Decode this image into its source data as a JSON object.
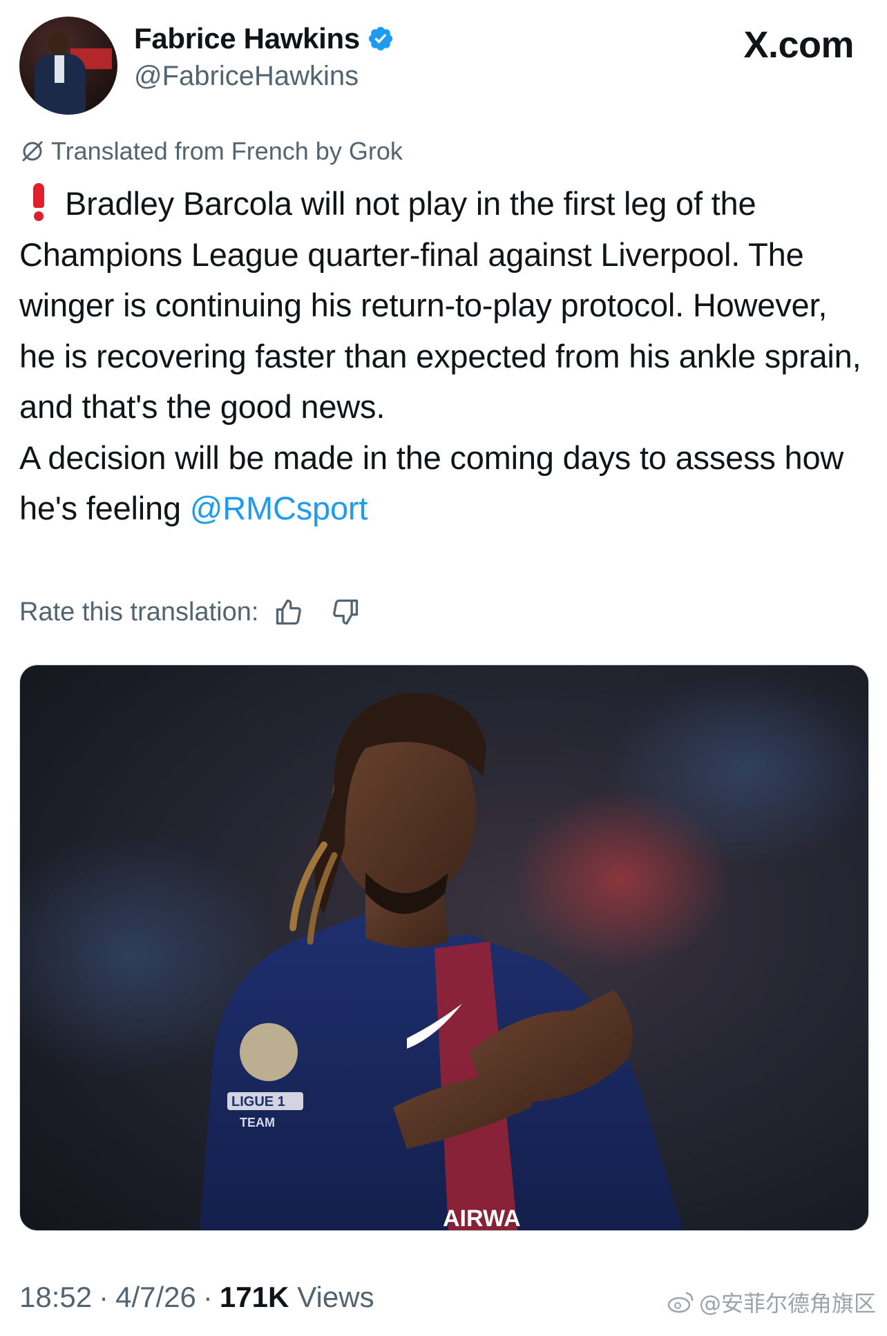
{
  "author": {
    "display_name": "Fabrice Hawkins",
    "handle": "@FabriceHawkins",
    "verified_color": "#1d9bf0",
    "avatar_icon": "profile-photo"
  },
  "site_brand": "X.com",
  "translation": {
    "notice": "Translated from French by Grok",
    "rate_label": "Rate this translation:",
    "thumbs_up_icon": "thumbs-up-icon",
    "thumbs_down_icon": "thumbs-down-icon"
  },
  "tweet": {
    "paragraph1": "Bradley Barcola will not play in the first leg of the Champions League quarter-final against Liverpool. The winger is continuing his return-to-play protocol. However, he is recovering faster than expected from his ankle sprain, and that's the good news.",
    "paragraph2": "A decision will be made in the coming days to assess how he's feeling",
    "mention": "@RMCsport",
    "alert_icon": "red-exclamation-icon"
  },
  "media": {
    "kit_badge_text": "LIGUE 1",
    "kit_team_text": "TEAM",
    "sponsor_text": "AIRWA"
  },
  "meta": {
    "time": "18:52",
    "separator": "·",
    "date": "4/7/26",
    "views_count": "171K",
    "views_label": "Views"
  },
  "watermark": {
    "text": "@安菲尔德角旗区"
  },
  "colors": {
    "text": "#0f1419",
    "secondary": "#536471",
    "link": "#1d9bf0",
    "alert": "#e0202a"
  }
}
